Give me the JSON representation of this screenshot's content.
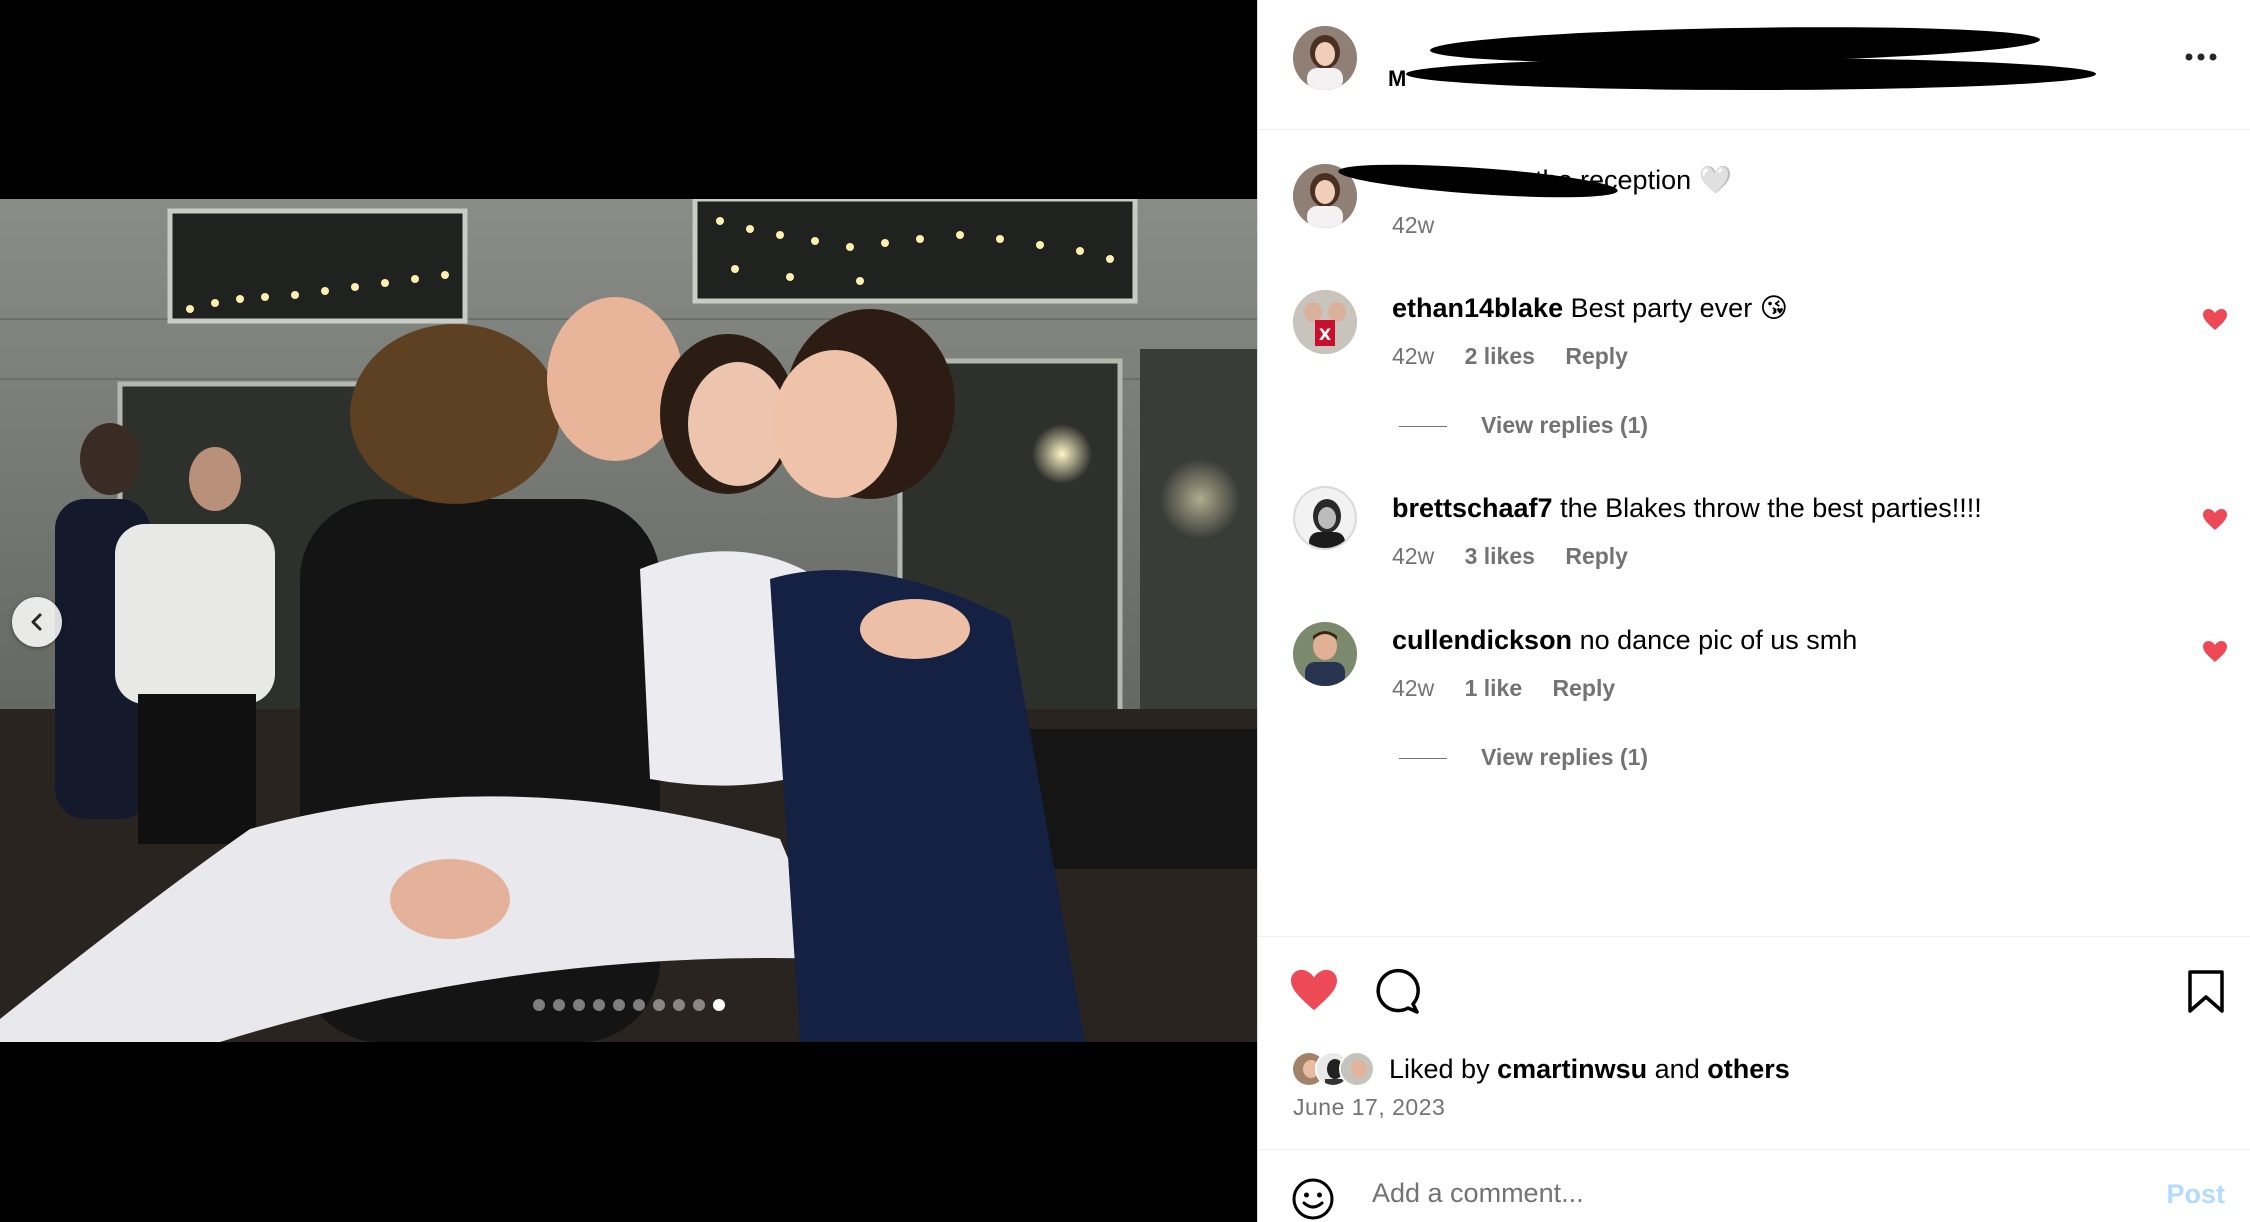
{
  "carousel": {
    "prev_icon": "chevron-left-icon",
    "dot_count": 10,
    "active_dot": 10
  },
  "header": {
    "username_visible": "M",
    "more_icon": "more-horizontal-icon"
  },
  "caption": {
    "text": "the reception",
    "emoji": "🤍",
    "time": "42w"
  },
  "comments": [
    {
      "username": "ethan14blake",
      "text": "Best party ever",
      "emoji": "😘",
      "time": "42w",
      "likes": "2 likes",
      "reply_label": "Reply",
      "liked": true,
      "view_replies": "View replies (1)"
    },
    {
      "username": "brettschaaf7",
      "text": "the Blakes throw the best parties!!!!",
      "time": "42w",
      "likes": "3 likes",
      "reply_label": "Reply",
      "liked": true
    },
    {
      "username": "cullendickson",
      "text": "no dance pic of us smh",
      "time": "42w",
      "likes": "1 like",
      "reply_label": "Reply",
      "liked": true,
      "view_replies": "View replies (1)"
    }
  ],
  "actions": {
    "like_icon": "heart-filled-icon",
    "comment_icon": "comment-icon",
    "save_icon": "bookmark-icon",
    "liked_by_prefix": "Liked by",
    "liked_by_user": "cmartinwsu",
    "liked_by_and": "and",
    "liked_by_others": "others",
    "date": "June 17, 2023"
  },
  "comment_box": {
    "emoji_icon": "smiley-icon",
    "placeholder": "Add a comment...",
    "post_label": "Post"
  },
  "colors": {
    "like_red": "#ed4956",
    "meta_gray": "#737373",
    "post_disabled_blue": "#b3dbff"
  }
}
